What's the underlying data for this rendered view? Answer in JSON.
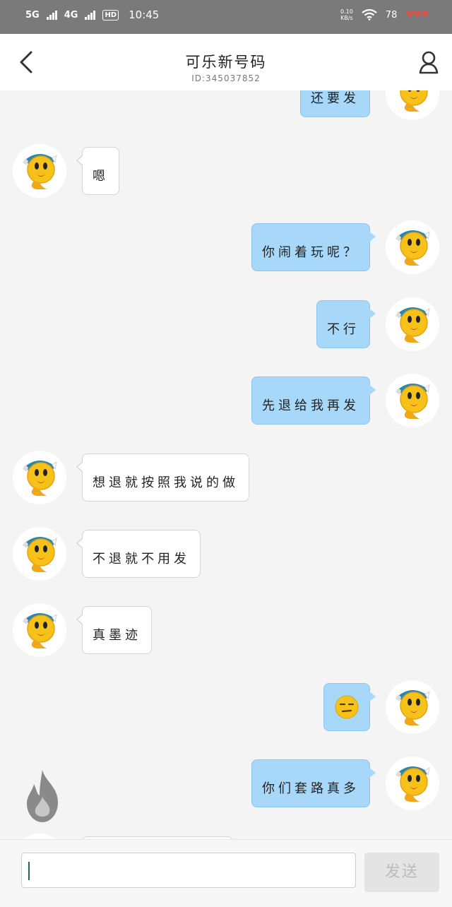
{
  "status_bar": {
    "net1": "5G",
    "net2": "4G",
    "hd": "HD",
    "time": "10:45",
    "speed_value": "0.10",
    "speed_unit": "KB/s",
    "battery": "78"
  },
  "header": {
    "title": "可乐新号码",
    "subtitle": "ID:345037852"
  },
  "messages": [
    {
      "side": "out",
      "text": "还要发"
    },
    {
      "side": "in",
      "text": "嗯"
    },
    {
      "side": "out",
      "text": "你闹着玩呢？"
    },
    {
      "side": "out",
      "text": "不行"
    },
    {
      "side": "out",
      "text": "先退给我再发"
    },
    {
      "side": "in",
      "text": "想退就按照我说的做"
    },
    {
      "side": "in",
      "text": "不退就不用发"
    },
    {
      "side": "in",
      "text": "真墨迹"
    },
    {
      "side": "out",
      "text": "",
      "emoji": "unamused-face"
    },
    {
      "side": "out",
      "text": "你们套路真多"
    }
  ],
  "input": {
    "value": "",
    "send_label": "发送"
  },
  "icons": {
    "back": "chevron-left-icon",
    "profile": "person-icon",
    "fire": "fire-icon"
  },
  "colors": {
    "outgoing_bubble": "#a8d8f9",
    "incoming_bubble": "#ffffff",
    "background": "#f4f4f4",
    "status_bar": "#7a7a7a"
  }
}
